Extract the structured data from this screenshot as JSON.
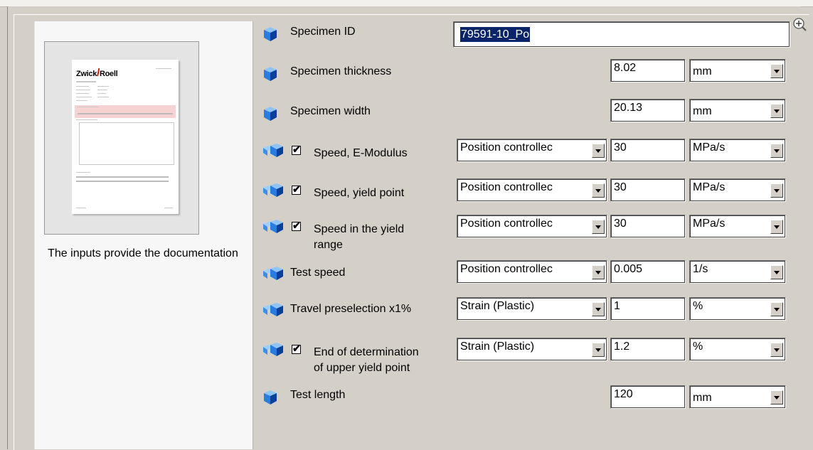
{
  "preview": {
    "logo_text_left": "Zwick",
    "logo_text_right": "Roell",
    "caption": "The inputs provide the documentation"
  },
  "rows": [
    {
      "label": "Specimen ID",
      "value": "79591-10_Po",
      "icon": "cube-icon"
    },
    {
      "label": "Specimen thickness",
      "value": "8.02",
      "unit": "mm",
      "icon": "cube-icon"
    },
    {
      "label": "Specimen width",
      "value": "20.13",
      "unit": "mm",
      "icon": "cube-icon"
    },
    {
      "label": "Speed, E-Modulus",
      "checked": true,
      "control": "Position controllec",
      "value": "30",
      "unit": "MPa/s",
      "icon": "multi-cube-icon"
    },
    {
      "label": "Speed, yield point",
      "checked": true,
      "control": "Position controllec",
      "value": "30",
      "unit": "MPa/s",
      "icon": "multi-cube-icon"
    },
    {
      "label_line1": "Speed in the yield",
      "label_line2": "range",
      "checked": true,
      "control": "Position controllec",
      "value": "30",
      "unit": "MPa/s",
      "icon": "multi-cube-icon"
    },
    {
      "label": "Test speed",
      "control": "Position controllec",
      "value": "0.005",
      "unit": "1/s",
      "icon": "multi-cube-icon"
    },
    {
      "label": "Travel preselection x1%",
      "control": "Strain (Plastic)",
      "value": "1",
      "unit": "%",
      "icon": "multi-cube-icon"
    },
    {
      "label_line1": "End of determination",
      "label_line2": "of upper yield point",
      "checked": true,
      "control": "Strain (Plastic)",
      "value": "1.2",
      "unit": "%",
      "icon": "multi-cube-icon"
    },
    {
      "label": "Test length",
      "value": "120",
      "unit": "mm",
      "icon": "cube-icon"
    }
  ],
  "colors": {
    "selection": "#0a246a",
    "cube_blue": "#1d6fd6",
    "window_bg": "#d4d0c8"
  }
}
